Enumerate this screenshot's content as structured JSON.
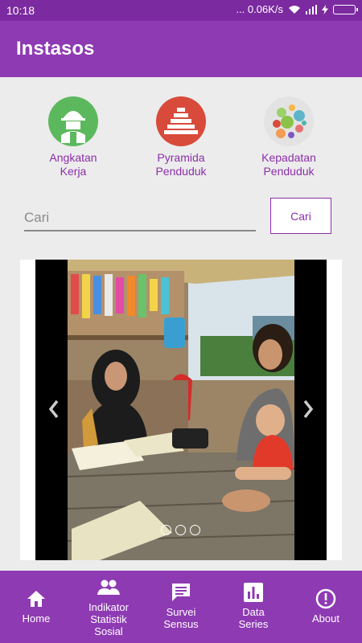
{
  "status_bar": {
    "time": "10:18",
    "network_speed": "... 0.06K/s"
  },
  "app_bar": {
    "title": "Instasos"
  },
  "features": [
    {
      "line1": "Angkatan",
      "line2": "Kerja",
      "color": "#5cb85c"
    },
    {
      "line1": "Pyramida",
      "line2": "Penduduk",
      "color": "#d84a3a"
    },
    {
      "line1": "Kepadatan",
      "line2": "Penduduk",
      "color": "#e3e3e3"
    }
  ],
  "search": {
    "placeholder": "Cari",
    "button_label": "Cari"
  },
  "carousel": {
    "dots": 3,
    "active_dot": 1
  },
  "bottom_nav": [
    {
      "label1": "Home",
      "label2": "",
      "label3": "",
      "icon": "home-icon"
    },
    {
      "label1": "Indikator",
      "label2": "Statistik",
      "label3": "Sosial",
      "icon": "people-icon"
    },
    {
      "label1": "Survei",
      "label2": "Sensus",
      "label3": "",
      "icon": "message-icon"
    },
    {
      "label1": "Data",
      "label2": "Series",
      "label3": "",
      "icon": "chart-icon"
    },
    {
      "label1": "About",
      "label2": "",
      "label3": "",
      "icon": "info-icon"
    }
  ],
  "colors": {
    "primary": "#8e3ab3",
    "status_bar": "#7b2aa0",
    "accent_text": "#8b2fa8",
    "background": "#ececec"
  }
}
